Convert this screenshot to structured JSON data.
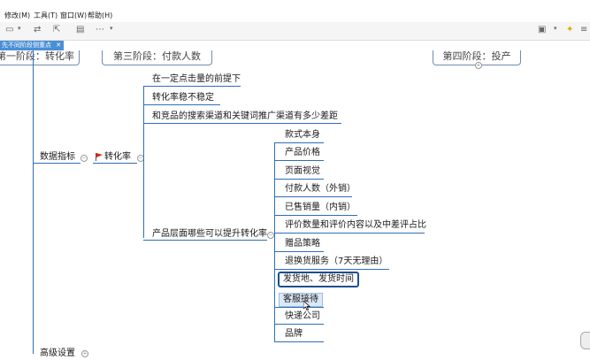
{
  "menu": [
    "修改(M)",
    "工具(T)",
    "窗口(W)",
    "帮助(H)"
  ],
  "tab": {
    "label": "先不同阶段侧重点",
    "close": "✕"
  },
  "stages": [
    "第一阶段：转化率",
    "第三阶段：付款人数",
    "第四阶段：投产"
  ],
  "root": {
    "label": "数据指标"
  },
  "conversion": {
    "label": "转化率"
  },
  "upper_branches": [
    "在一定点击量的前提下",
    "转化率稳不稳定",
    "和竞品的搜索渠道和关键词推广渠道有多少差距"
  ],
  "product_branch": {
    "label": "产品层面哪些可以提升转化率"
  },
  "product_items": [
    "款式本身",
    "产品价格",
    "页面视觉",
    "付款人数（外销）",
    "已售销量（内销）",
    "评价数量和评价内容以及中差评占比",
    "赠品策略",
    "退换货服务（7天无理由）",
    "发货地、发货时间",
    "客服接待",
    "快递公司",
    "品牌"
  ],
  "bottom_partial": "高级设置"
}
